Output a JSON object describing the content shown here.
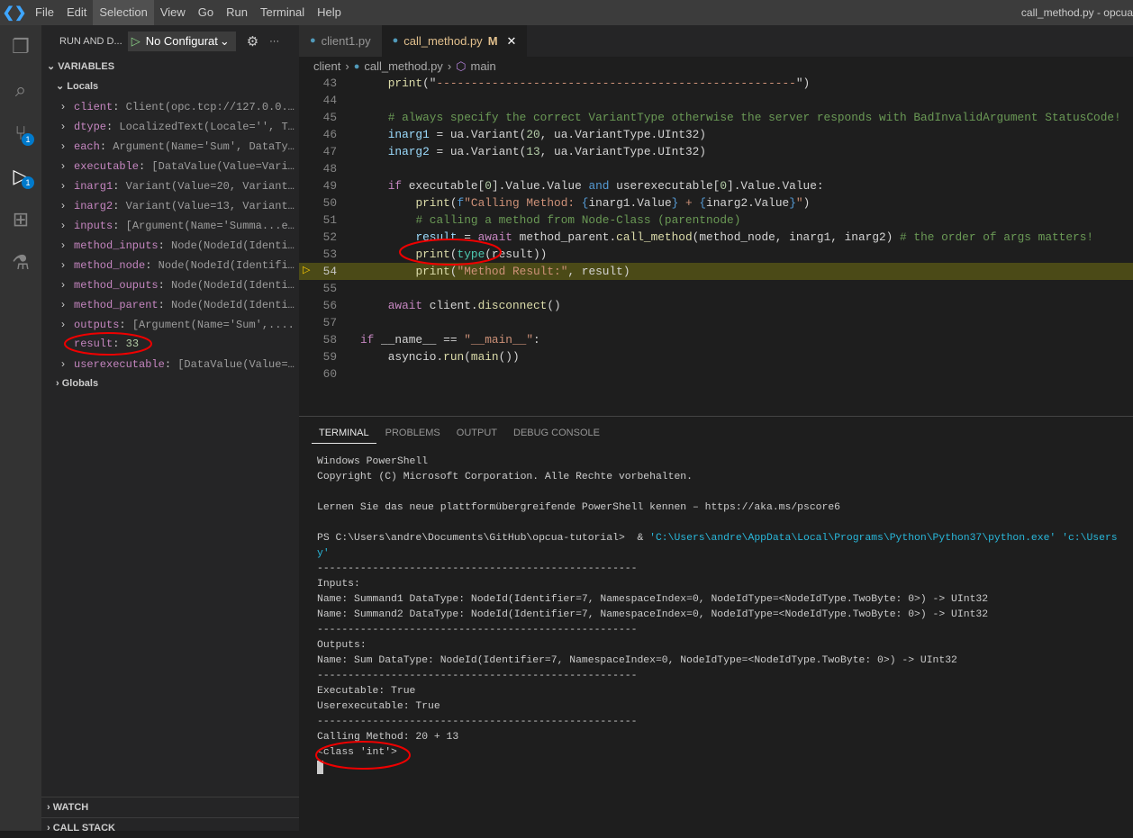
{
  "titlebar": {
    "menus": [
      "File",
      "Edit",
      "Selection",
      "View",
      "Go",
      "Run",
      "Terminal",
      "Help"
    ],
    "title": "call_method.py - opcua"
  },
  "activity": {
    "badges": {
      "scm": "1",
      "debug": "1"
    }
  },
  "sidebar": {
    "header": "RUN AND D...",
    "config": "No Configurat",
    "variables": "VARIABLES",
    "locals": "Locals",
    "globals": "Globals",
    "watch": "WATCH",
    "callstack": "CALL STACK",
    "vars": [
      {
        "name": "client",
        "value": "Client(opc.tcp://127.0.0.…",
        "expand": true
      },
      {
        "name": "dtype",
        "value": "LocalizedText(Locale='', T…",
        "expand": true
      },
      {
        "name": "each",
        "value": "Argument(Name='Sum', DataTy…",
        "expand": true
      },
      {
        "name": "executable",
        "value": "[DataValue(Value=Vari…",
        "expand": true
      },
      {
        "name": "inarg1",
        "value": "Variant(Value=20, Variant…",
        "expand": true
      },
      {
        "name": "inarg2",
        "value": "Variant(Value=13, Variant…",
        "expand": true
      },
      {
        "name": "inputs",
        "value": "[Argument(Name='Summa...e…",
        "expand": true
      },
      {
        "name": "method_inputs",
        "value": "Node(NodeId(Identi…",
        "expand": true
      },
      {
        "name": "method_node",
        "value": "Node(NodeId(Identifi…",
        "expand": true
      },
      {
        "name": "method_ouputs",
        "value": "Node(NodeId(Identi…",
        "expand": true
      },
      {
        "name": "method_parent",
        "value": "Node(NodeId(Identi…",
        "expand": true
      },
      {
        "name": "outputs",
        "value": "[Argument(Name='Sum',....",
        "expand": true
      },
      {
        "name": "result",
        "value": "33",
        "expand": false
      },
      {
        "name": "userexecutable",
        "value": "[DataValue(Value=…",
        "expand": true
      }
    ]
  },
  "tabs": [
    {
      "label": "client1.py"
    },
    {
      "label": "call_method.py",
      "status": "M"
    }
  ],
  "breadcrumb": [
    "client",
    "call_method.py",
    "main"
  ],
  "code": [
    {
      "n": "43",
      "tok": [
        [
          "    ",
          ""
        ],
        [
          "print",
          "f"
        ],
        [
          "(\"",
          ""
        ],
        [
          "----------------------------------------------------",
          "s"
        ],
        [
          "\")",
          ""
        ]
      ]
    },
    {
      "n": "44",
      "tok": []
    },
    {
      "n": "45",
      "tok": [
        [
          "    ",
          ""
        ],
        [
          "# always specify the correct VariantType otherwise the server responds with BadInvalidArgument StatusCode!",
          "c"
        ]
      ]
    },
    {
      "n": "46",
      "tok": [
        [
          "    ",
          ""
        ],
        [
          "inarg1",
          "v"
        ],
        [
          " = ua.Variant(",
          ""
        ],
        [
          "20",
          "n"
        ],
        [
          ", ua.VariantType.UInt32)",
          ""
        ]
      ]
    },
    {
      "n": "47",
      "tok": [
        [
          "    ",
          ""
        ],
        [
          "inarg2",
          "v"
        ],
        [
          " = ua.Variant(",
          ""
        ],
        [
          "13",
          "n"
        ],
        [
          ", ua.VariantType.UInt32)",
          ""
        ]
      ]
    },
    {
      "n": "48",
      "tok": []
    },
    {
      "n": "49",
      "tok": [
        [
          "    ",
          ""
        ],
        [
          "if",
          "k"
        ],
        [
          " executable[",
          ""
        ],
        [
          "0",
          "n"
        ],
        [
          "].Value.Value ",
          ""
        ],
        [
          "and",
          "b"
        ],
        [
          " userexecutable[",
          ""
        ],
        [
          "0",
          "n"
        ],
        [
          "].Value.Value:",
          ""
        ]
      ]
    },
    {
      "n": "50",
      "tok": [
        [
          "        ",
          ""
        ],
        [
          "print",
          "f"
        ],
        [
          "(",
          ""
        ],
        [
          "f",
          "b"
        ],
        [
          "\"Calling Method: ",
          "s"
        ],
        [
          "{",
          "b"
        ],
        [
          "inarg1.Value",
          ""
        ],
        [
          "}",
          "b"
        ],
        [
          " + ",
          "s"
        ],
        [
          "{",
          "b"
        ],
        [
          "inarg2.Value",
          ""
        ],
        [
          "}",
          "b"
        ],
        [
          "\"",
          "s"
        ],
        [
          ")",
          ""
        ]
      ]
    },
    {
      "n": "51",
      "tok": [
        [
          "        ",
          ""
        ],
        [
          "# calling a method from Node-Class (parentnode)",
          "c"
        ]
      ]
    },
    {
      "n": "52",
      "tok": [
        [
          "        ",
          ""
        ],
        [
          "result",
          "v"
        ],
        [
          " = ",
          ""
        ],
        [
          "await",
          "k"
        ],
        [
          " method_parent.",
          ""
        ],
        [
          "call_method",
          "f"
        ],
        [
          "(method_node, inarg1, inarg2) ",
          ""
        ],
        [
          "# the order of args matters!",
          "c"
        ]
      ]
    },
    {
      "n": "53",
      "tok": [
        [
          "        ",
          ""
        ],
        [
          "print",
          "f"
        ],
        [
          "(",
          ""
        ],
        [
          "type",
          "t"
        ],
        [
          "(result))",
          ""
        ]
      ]
    },
    {
      "n": "54",
      "cur": true,
      "tok": [
        [
          "        ",
          ""
        ],
        [
          "print",
          "f"
        ],
        [
          "(",
          ""
        ],
        [
          "\"Method Result:\"",
          "s"
        ],
        [
          ", result)",
          ""
        ]
      ]
    },
    {
      "n": "55",
      "tok": []
    },
    {
      "n": "56",
      "tok": [
        [
          "    ",
          ""
        ],
        [
          "await",
          "k"
        ],
        [
          " client.",
          ""
        ],
        [
          "disconnect",
          "f"
        ],
        [
          "()",
          ""
        ]
      ]
    },
    {
      "n": "57",
      "tok": []
    },
    {
      "n": "58",
      "tok": [
        [
          "if",
          "k"
        ],
        [
          " __name__ == ",
          ""
        ],
        [
          "\"__main__\"",
          "s"
        ],
        [
          ":",
          ""
        ]
      ]
    },
    {
      "n": "59",
      "tok": [
        [
          "    asyncio.",
          ""
        ],
        [
          "run",
          "f"
        ],
        [
          "(",
          ""
        ],
        [
          "main",
          "f"
        ],
        [
          "())",
          ""
        ]
      ]
    },
    {
      "n": "60",
      "tok": []
    }
  ],
  "panel": {
    "tabs": [
      "TERMINAL",
      "PROBLEMS",
      "OUTPUT",
      "DEBUG CONSOLE"
    ]
  },
  "terminal": [
    [
      [
        "Windows PowerShell",
        ""
      ]
    ],
    [
      [
        "Copyright (C) Microsoft Corporation. Alle Rechte vorbehalten.",
        ""
      ]
    ],
    [],
    [
      [
        "Lernen Sie das neue plattformübergreifende PowerShell kennen – https://aka.ms/pscore6",
        ""
      ]
    ],
    [],
    [
      [
        "PS C:\\Users\\andre\\Documents\\GitHub\\opcua-tutorial>  & ",
        ""
      ],
      [
        "'C:\\Users\\andre\\AppData\\Local\\Programs\\Python\\Python37\\python.exe' 'c:\\Users",
        "cy"
      ]
    ],
    [
      [
        "y'",
        "cy"
      ]
    ],
    [
      [
        "----------------------------------------------------",
        ""
      ]
    ],
    [
      [
        "Inputs:",
        ""
      ]
    ],
    [
      [
        "Name: Summand1 DataType: NodeId(Identifier=7, NamespaceIndex=0, NodeIdType=<NodeIdType.TwoByte: 0>) -> UInt32",
        ""
      ]
    ],
    [
      [
        "Name: Summand2 DataType: NodeId(Identifier=7, NamespaceIndex=0, NodeIdType=<NodeIdType.TwoByte: 0>) -> UInt32",
        ""
      ]
    ],
    [
      [
        "----------------------------------------------------",
        ""
      ]
    ],
    [
      [
        "Outputs:",
        ""
      ]
    ],
    [
      [
        "Name: Sum DataType: NodeId(Identifier=7, NamespaceIndex=0, NodeIdType=<NodeIdType.TwoByte: 0>) -> UInt32",
        ""
      ]
    ],
    [
      [
        "----------------------------------------------------",
        ""
      ]
    ],
    [
      [
        "Executable: True",
        ""
      ]
    ],
    [
      [
        "Userexecutable: True",
        ""
      ]
    ],
    [
      [
        "----------------------------------------------------",
        ""
      ]
    ],
    [
      [
        "Calling Method: 20 + 13",
        ""
      ]
    ],
    [
      [
        "<class 'int'>",
        ""
      ]
    ]
  ]
}
